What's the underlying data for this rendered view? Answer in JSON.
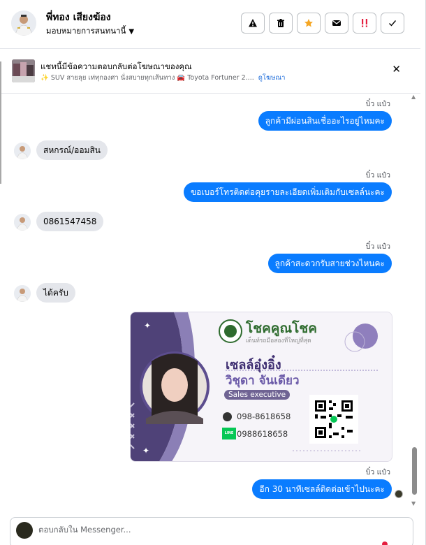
{
  "header": {
    "contact_name": "พี่ทอง เสียงฆ้อง",
    "assign_label": "มอบหมายการสนทนานี้",
    "actions": [
      {
        "icon": "warning-icon",
        "color": "#050505"
      },
      {
        "icon": "trash-icon",
        "color": "#050505"
      },
      {
        "icon": "star-icon",
        "color": "#f5a623"
      },
      {
        "icon": "mail-icon",
        "color": "#050505"
      },
      {
        "icon": "important-icon",
        "color": "#e41e3f"
      },
      {
        "icon": "check-icon",
        "color": "#050505"
      }
    ]
  },
  "ad_banner": {
    "title": "แชทนี้มีข้อความตอบกลับต่อโฆษณาของคุณ",
    "description": "✨ SUV สายลุย เท่ทุกองศา นั่งสบายทุกเส้นทาง 🚘 Toyota Fortuner 2....",
    "link": "ดูโฆษณา"
  },
  "messages": [
    {
      "direction": "out",
      "sender": "บิ๋ว แป๋ว",
      "text": "ลูกค้ามีผ่อนสินเชื่ออะไรอยู่ไหมคะ"
    },
    {
      "direction": "in",
      "text": "สหกรณ์/ออมสิน"
    },
    {
      "direction": "out",
      "sender": "บิ๋ว แป๋ว",
      "text": "ขอเบอร์โทรติดต่อคุยรายละเอียดเพิ่มเติมกับเซลล์นะคะ"
    },
    {
      "direction": "in",
      "text": "0861547458"
    },
    {
      "direction": "out",
      "sender": "บิ๋ว แป๋ว",
      "text": "ลูกค้าสะดวกรับสายช่วงไหนคะ"
    },
    {
      "direction": "in",
      "text": "ได้ครับ"
    },
    {
      "direction": "out",
      "sender": "บิ๋ว แป๋ว",
      "text": "อีก 30 นาทีเซลล์ติดต่อเข้าไปนะคะ"
    }
  ],
  "business_card": {
    "brand": "โชคคูณโชค",
    "tagline": "เต็นท์รถมือสองที่ใหญ่ที่สุด",
    "nickname": "เซลล์อุ๋งอิ๋ง",
    "full_name": "วิชุดา จันเดียว",
    "role": "Sales executive",
    "phone": "098-8618658",
    "line_id": "0988618658",
    "line_badge": "LINE",
    "colors": {
      "accent": "#6b5aa8",
      "dark": "#4f4278",
      "brand": "#2e6b2e"
    }
  },
  "composer": {
    "placeholder": "ตอบกลับใน Messenger..."
  }
}
